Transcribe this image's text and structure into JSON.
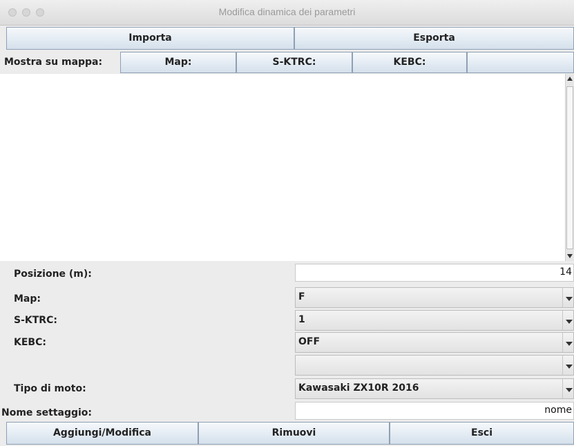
{
  "window": {
    "title": "Modifica dinamica dei parametri"
  },
  "toolbar": {
    "import_label": "Importa",
    "export_label": "Esporta"
  },
  "map_bar": {
    "label": "Mostra su mappa:",
    "buttons": [
      "Map:",
      "S-KTRC:",
      "KEBC:",
      ""
    ]
  },
  "textarea": {
    "value": ""
  },
  "form": {
    "posizione": {
      "label": "Posizione (m):",
      "value": "14"
    },
    "map": {
      "label": "Map:",
      "value": "F"
    },
    "sktrc": {
      "label": "S-KTRC:",
      "value": "1"
    },
    "kebc": {
      "label": "KEBC:",
      "value": "OFF"
    },
    "extra": {
      "label": "",
      "value": ""
    },
    "tipo_moto": {
      "label": "Tipo di moto:",
      "value": "Kawasaki ZX10R 2016"
    },
    "nome": {
      "label": "Nome settaggio:",
      "value": "nome"
    }
  },
  "actions": {
    "add_label": "Aggiungi/Modifica",
    "remove_label": "Rimuovi",
    "exit_label": "Esci"
  }
}
